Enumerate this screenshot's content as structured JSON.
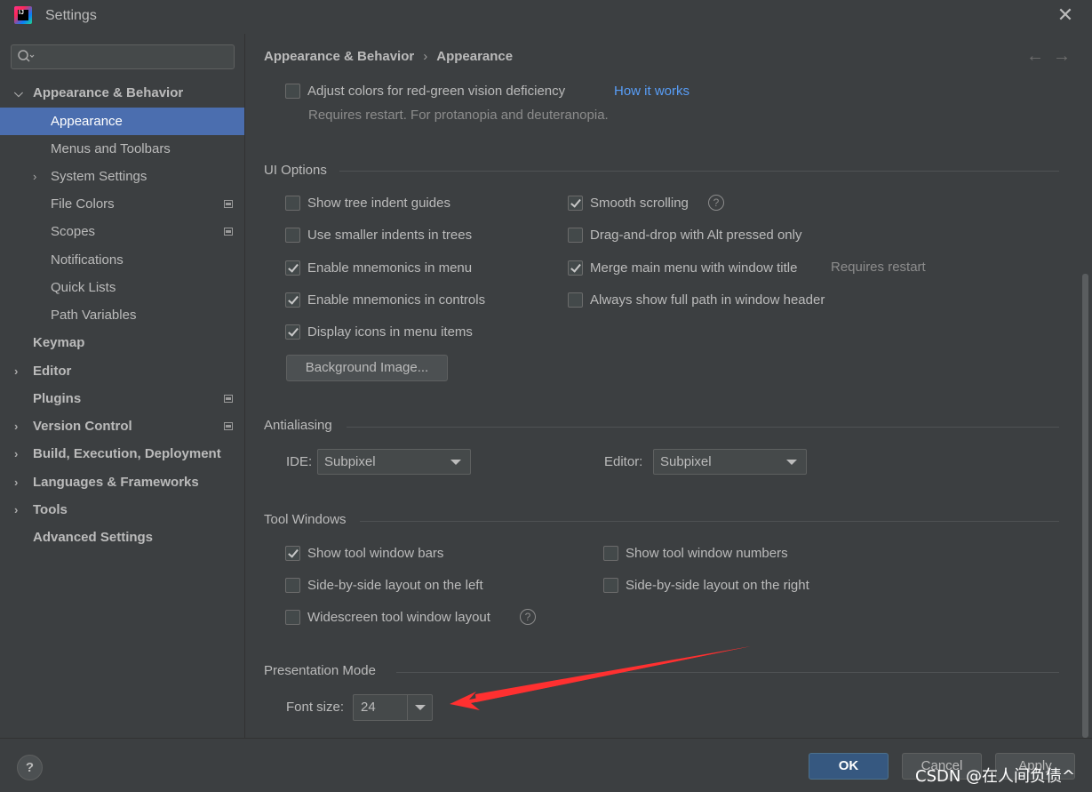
{
  "window": {
    "title": "Settings"
  },
  "search": {
    "placeholder": ""
  },
  "sidebar": {
    "items": [
      {
        "label": "Appearance & Behavior"
      },
      {
        "label": "Appearance"
      },
      {
        "label": "Menus and Toolbars"
      },
      {
        "label": "System Settings"
      },
      {
        "label": "File Colors"
      },
      {
        "label": "Scopes"
      },
      {
        "label": "Notifications"
      },
      {
        "label": "Quick Lists"
      },
      {
        "label": "Path Variables"
      },
      {
        "label": "Keymap"
      },
      {
        "label": "Editor"
      },
      {
        "label": "Plugins"
      },
      {
        "label": "Version Control"
      },
      {
        "label": "Build, Execution, Deployment"
      },
      {
        "label": "Languages & Frameworks"
      },
      {
        "label": "Tools"
      },
      {
        "label": "Advanced Settings"
      }
    ]
  },
  "breadcrumb": {
    "parent": "Appearance & Behavior",
    "separator": "›",
    "current": "Appearance"
  },
  "vision": {
    "label": "Adjust colors for red-green vision deficiency",
    "link": "How it works",
    "hint": "Requires restart. For protanopia and deuteranopia."
  },
  "ui_options": {
    "title": "UI Options",
    "left": [
      {
        "label": "Show tree indent guides",
        "checked": false
      },
      {
        "label": "Use smaller indents in trees",
        "checked": false
      },
      {
        "label": "Enable mnemonics in menu",
        "checked": true
      },
      {
        "label": "Enable mnemonics in controls",
        "checked": true
      },
      {
        "label": "Display icons in menu items",
        "checked": true
      }
    ],
    "right": [
      {
        "label": "Smooth scrolling",
        "checked": true
      },
      {
        "label": "Drag-and-drop with Alt pressed only",
        "checked": false
      },
      {
        "label": "Merge main menu with window title",
        "checked": true,
        "hint": "Requires restart"
      },
      {
        "label": "Always show full path in window header",
        "checked": false
      }
    ],
    "background_button": "Background Image..."
  },
  "antialiasing": {
    "title": "Antialiasing",
    "ide_label": "IDE:",
    "ide_value": "Subpixel",
    "editor_label": "Editor:",
    "editor_value": "Subpixel"
  },
  "tool_windows": {
    "title": "Tool Windows",
    "items": [
      {
        "label": "Show tool window bars",
        "checked": true
      },
      {
        "label": "Show tool window numbers",
        "checked": false
      },
      {
        "label": "Side-by-side layout on the left",
        "checked": false
      },
      {
        "label": "Side-by-side layout on the right",
        "checked": false
      },
      {
        "label": "Widescreen tool window layout",
        "checked": false
      }
    ]
  },
  "presentation": {
    "title": "Presentation Mode",
    "font_label": "Font size:",
    "font_value": "24"
  },
  "footer": {
    "help": "?",
    "ok": "OK",
    "cancel": "Cancel",
    "apply": "Apply",
    "watermark": "CSDN @在人间负债^"
  },
  "colors": {
    "background": "#3c3f41",
    "selection": "#4b6eaf",
    "link": "#589df6",
    "primary_button": "#365880",
    "annotation_arrow": "#ff3030"
  }
}
